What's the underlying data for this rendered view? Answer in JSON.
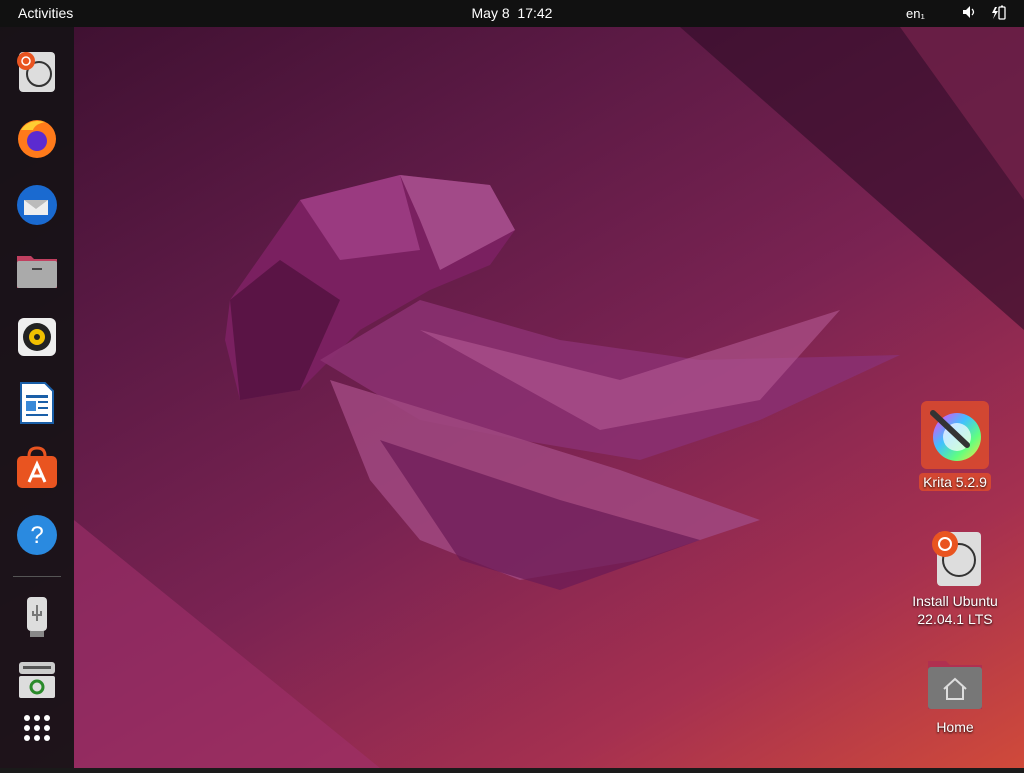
{
  "topbar": {
    "activities": "Activities",
    "date": "May 8",
    "time": "17:42",
    "language": "en₁",
    "volume_icon": "speaker-icon",
    "battery_icon": "battery-charging-icon"
  },
  "dock": {
    "items": [
      {
        "name": "Install Ubuntu",
        "icon": "ubiquity-installer-icon"
      },
      {
        "name": "Firefox",
        "icon": "firefox-icon"
      },
      {
        "name": "Thunderbird",
        "icon": "thunderbird-icon"
      },
      {
        "name": "Files",
        "icon": "files-icon"
      },
      {
        "name": "Rhythmbox",
        "icon": "rhythmbox-icon"
      },
      {
        "name": "LibreOffice Writer",
        "icon": "writer-icon"
      },
      {
        "name": "Ubuntu Software",
        "icon": "software-icon"
      },
      {
        "name": "Help",
        "icon": "help-icon"
      },
      {
        "name": "USB Drive",
        "icon": "usb-drive-icon"
      },
      {
        "name": "Trash",
        "icon": "trash-icon"
      }
    ],
    "apps_grid": "show-applications-icon",
    "help_glyph": "?"
  },
  "desktop": {
    "icons": [
      {
        "label": "Krita 5.2.9",
        "selected": true
      },
      {
        "label": "Install Ubuntu 22.04.1 LTS"
      },
      {
        "label": "Home"
      }
    ]
  },
  "colors": {
    "accent": "#e95420",
    "topbar": "#111111",
    "dock": "#161216"
  }
}
